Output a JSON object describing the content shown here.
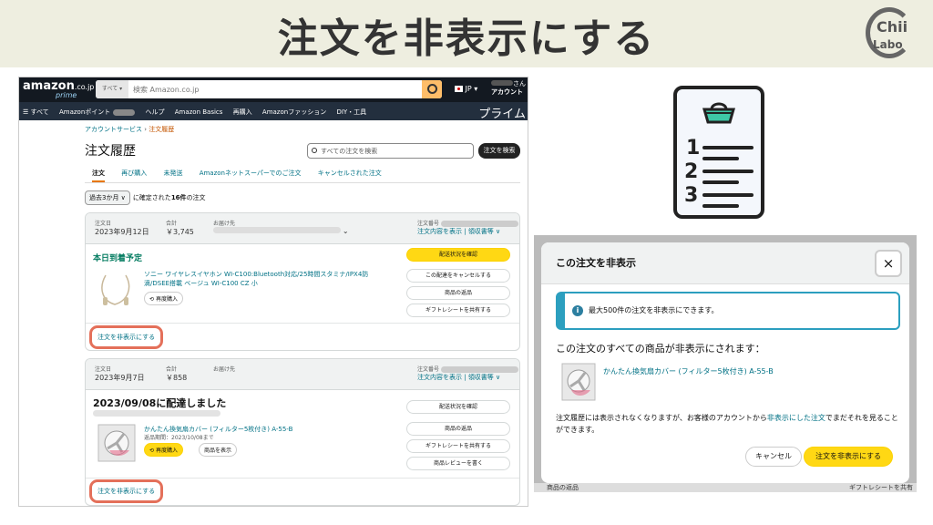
{
  "slide": {
    "title": "注文を非表示にする",
    "logo_top": "Chii",
    "logo_bottom": "Labo"
  },
  "amazon": {
    "logo": "amazon",
    "logo_tld": ".co.jp",
    "logo_prime": "prime",
    "search_category": "すべて ▾",
    "search_placeholder": "検索 Amazon.co.jp",
    "lang": "JP ▾",
    "account_top": "さん",
    "account": "アカウント",
    "nav": {
      "all": "☰ すべて",
      "points": "Amazonポイント",
      "help": "ヘルプ",
      "basics": "Amazon Basics",
      "rebuy": "再購入",
      "fashion": "Amazonファッション",
      "diy": "DIY・工具",
      "prime": "プライム"
    },
    "breadcrumb": {
      "root": "アカウントサービス",
      "sep": "›",
      "current": "注文履歴"
    },
    "page_title": "注文履歴",
    "order_search_placeholder": "すべての注文を検索",
    "order_search_button": "注文を検索",
    "tabs": [
      "注文",
      "再び購入",
      "未発送",
      "Amazonネットスーパーでのご注文",
      "キャンセルされた注文"
    ],
    "period": {
      "select": "過去3か月 ∨",
      "text_pre": "に確定された",
      "count": "16件",
      "text_post": "の注文"
    },
    "order_labels": {
      "date": "注文日",
      "total": "合計",
      "ship": "お届け先",
      "order_no": "注文番号",
      "details": "注文内容を表示",
      "receipt": "領収書等 ∨"
    },
    "orders": [
      {
        "date": "2023年9月12日",
        "total": "￥3,745",
        "status": "本日到着予定",
        "product": "ソニー ワイヤレスイヤホン WI-C100:Bluetooth対応/25時間スタミナ/IPX4防滴/DSEE搭載 ベージュ WI-C100 CZ 小",
        "rebuy": "再度購入",
        "buttons": [
          "配送状況を確認",
          "この配達をキャンセルする",
          "商品の返品",
          "ギフトレシートを共有する"
        ],
        "hide": "注文を非表示にする"
      },
      {
        "date": "2023年9月7日",
        "total": "￥858",
        "status": "2023/09/08に配達しました",
        "product": "かんたん換気扇カバー (フィルター5枚付き) A-55-B",
        "return_period": "返品期間：2023/10/08まで",
        "rebuy": "再度購入",
        "view": "商品を表示",
        "buttons": [
          "配送状況を確認",
          "商品の返品",
          "ギフトレシートを共有する",
          "商品レビューを書く"
        ],
        "hide": "注文を非表示にする"
      }
    ]
  },
  "clipboard": {
    "numbers": [
      "1",
      "2",
      "3"
    ],
    "accent": "#3ec7a6"
  },
  "dialog": {
    "title": "この注文を非表示",
    "close": "×",
    "info": "最大500件の注文を非表示にできます。",
    "subtitle": "この注文のすべての商品が非表示にされます：",
    "product": "かんたん換気扇カバー (フィルター5枚付き) A-55-B",
    "body_pre": "注文履歴には表示されなくなりますが、お客様のアカウントから",
    "body_link": "非表示にした注文",
    "body_post": "でまだそれを見ることができます。",
    "cancel": "キャンセル",
    "confirm": "注文を非表示にする",
    "bg_left": "商品の返品",
    "bg_right": "ギフトレシートを共有"
  }
}
